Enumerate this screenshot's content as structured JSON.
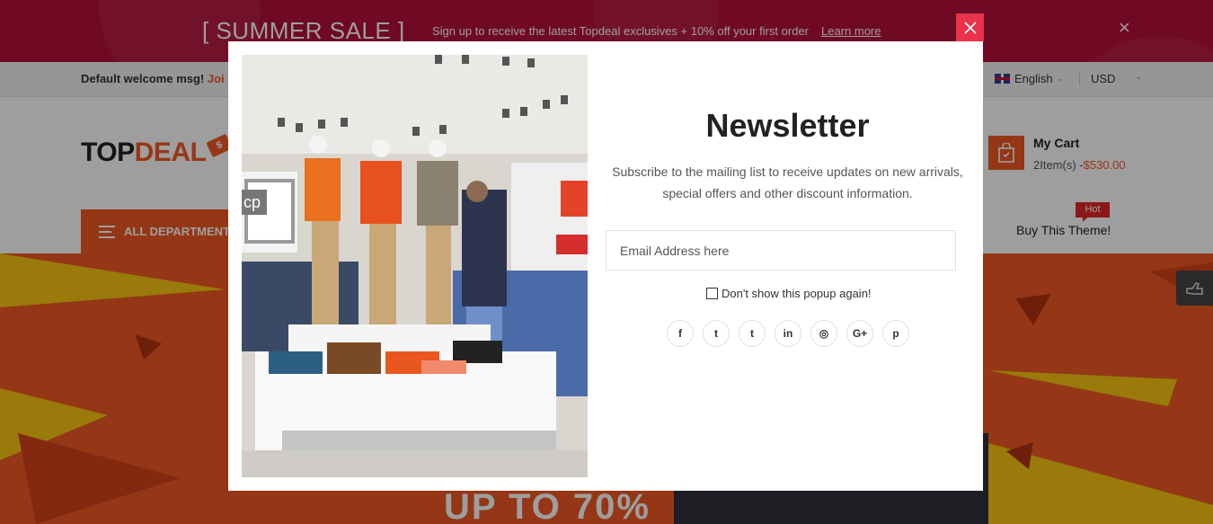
{
  "promo": {
    "title": "[ SUMMER SALE ]",
    "text": "Sign up to receive the latest Topdeal exclusives + 10% off your first order",
    "link": "Learn more",
    "close": "×"
  },
  "topbar": {
    "welcome": "Default welcome msg! ",
    "join": "Joi",
    "language": "English",
    "currency": "USD",
    "chevron": "⌄"
  },
  "header": {
    "logo_top": "TOP",
    "logo_deal": "DEAL",
    "logo_tag": "$",
    "cart_title": "My Cart",
    "cart_items": "2Item(s) -",
    "cart_price": "$530.00",
    "departments": "ALL DEPARTMENT",
    "buy_theme": "Buy This Theme!",
    "hot_badge": "Hot"
  },
  "hero": {
    "headline": "UP TO 70%"
  },
  "modal": {
    "title": "Newsletter",
    "description": "Subscribe to the mailing list to receive updates on new arrivals, special offers and other discount information.",
    "email_placeholder": "Email Address here",
    "dont_show": "Don't show this popup again!",
    "store_sign": "cp",
    "social": [
      {
        "icon": "facebook-icon",
        "glyph": "f"
      },
      {
        "icon": "twitter-icon",
        "glyph": "t"
      },
      {
        "icon": "tumblr-icon",
        "glyph": "t"
      },
      {
        "icon": "linkedin-icon",
        "glyph": "in"
      },
      {
        "icon": "instagram-icon",
        "glyph": "◎"
      },
      {
        "icon": "google-plus-icon",
        "glyph": "G+"
      },
      {
        "icon": "pinterest-icon",
        "glyph": "p"
      }
    ]
  },
  "colors": {
    "promo_bg": "#b3103a",
    "accent": "#f15a24",
    "close_button": "#e8334a"
  }
}
